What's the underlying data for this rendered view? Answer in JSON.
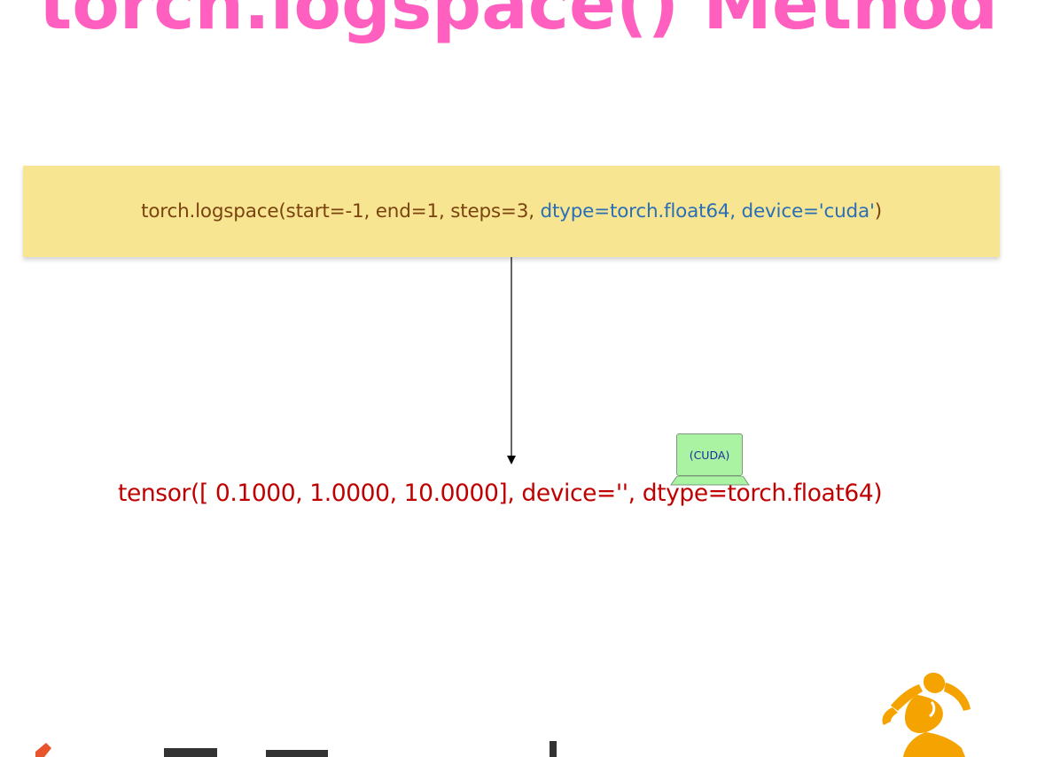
{
  "title": "torch.logspace() Method",
  "code": {
    "prefix": "torch.logspace(start=-1, end=1, steps=3, ",
    "highlighted": "dtype=torch.float64, device='cuda'",
    "suffix": ")"
  },
  "result": {
    "before": "tensor([ 0.1000, 1.0000, 10.0000], device=",
    "device_value": "''",
    "after": ", dtype=torch.float64)"
  },
  "note": {
    "label": "(CUDA)"
  },
  "colors": {
    "title": "#ff5fbf",
    "code_bg": "#f8e592",
    "code_text": "#7a4310",
    "code_highlight": "#2a6fb5",
    "result_text": "#c00000",
    "note_bg": "#a9f3a3",
    "note_text": "#1c2f9a",
    "arrow": "#000000",
    "logo_orange": "#f5a300",
    "logo_red": "#e8542c"
  },
  "icons": {
    "note_base": "laptop-base-icon",
    "logo_left": "brand-logo-fragment-icon",
    "logo_right": "dancer-figure-icon"
  }
}
